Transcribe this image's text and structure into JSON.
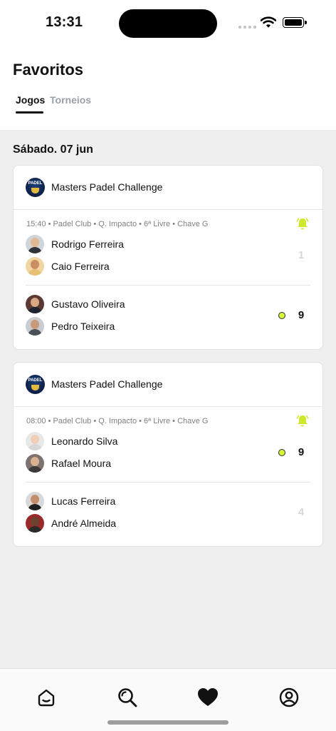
{
  "status_bar": {
    "time": "13:31"
  },
  "header": {
    "title": "Favoritos",
    "tabs": [
      {
        "label": "Jogos",
        "active": true
      },
      {
        "label": "Torneios",
        "active": false
      }
    ]
  },
  "date_label": "Sábado. 07 jun",
  "colors": {
    "accent": "#cde82e",
    "winner_dot": "#d6f23a",
    "loser_score": "#d7d7d7"
  },
  "matches": [
    {
      "tournament": "Masters Padel Challenge",
      "meta": "15:40 • Padel Club  • Q. Impacto • 6ª Livre • Chave G",
      "team1": {
        "players": [
          "Rodrigo Ferreira",
          "Caio Ferreira"
        ],
        "score": "1"
      },
      "team2": {
        "players": [
          "Gustavo Oliveira",
          "Pedro Teixeira"
        ],
        "score": "9"
      },
      "winner": 2
    },
    {
      "tournament": "Masters Padel Challenge",
      "meta": "08:00 • Padel Club • Q. Impacto • 6ª Livre • Chave G",
      "team1": {
        "players": [
          "Leonardo Silva",
          "Rafael Moura"
        ],
        "score": "9"
      },
      "team2": {
        "players": [
          "Lucas Ferreira",
          "André Almeida"
        ],
        "score": "4"
      },
      "winner": 1
    }
  ],
  "logo_text": "PADEL",
  "tabbar": {
    "items": [
      {
        "icon": "home-icon"
      },
      {
        "icon": "search-icon"
      },
      {
        "icon": "heart-icon",
        "active": true
      },
      {
        "icon": "profile-icon"
      }
    ]
  }
}
